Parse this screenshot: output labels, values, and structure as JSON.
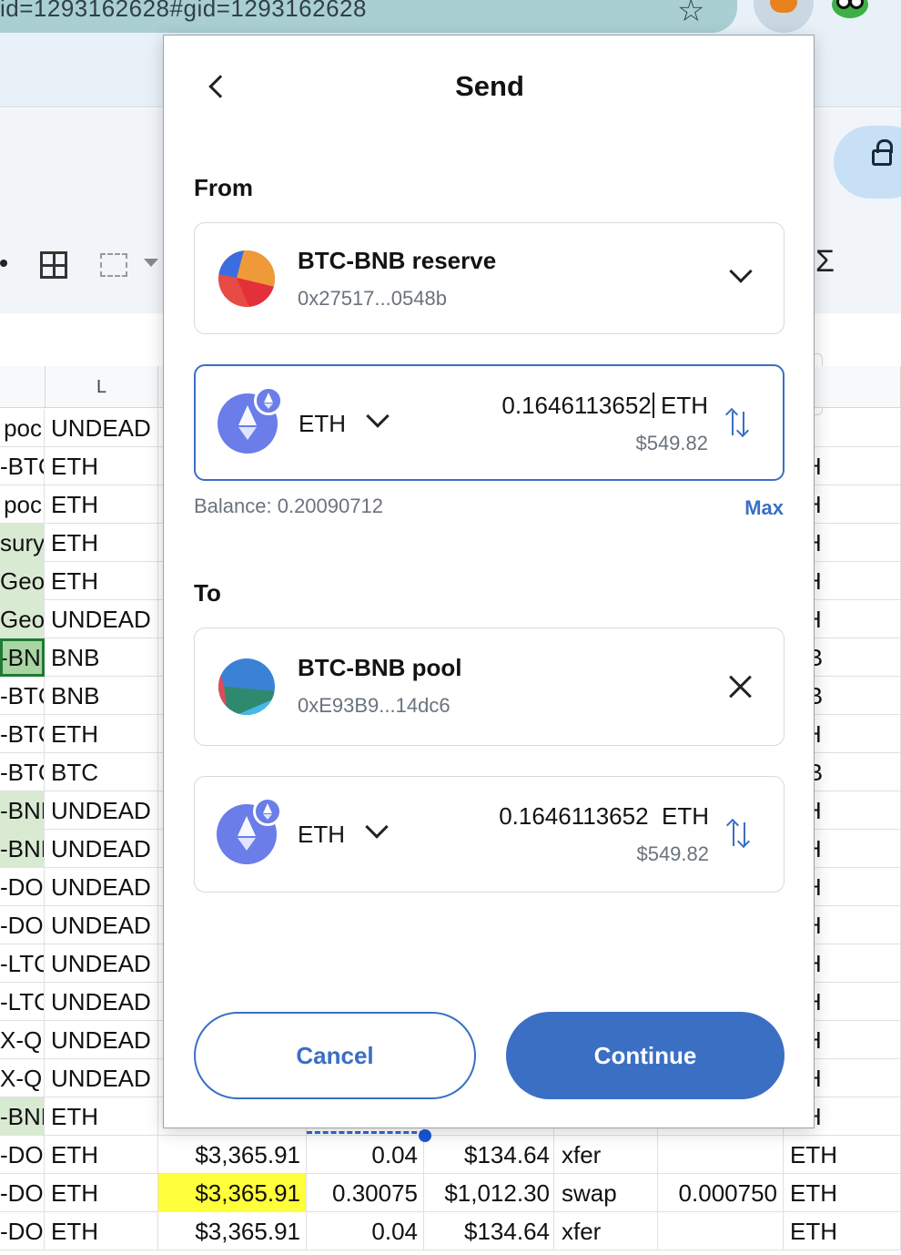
{
  "browser": {
    "url_fragment": "id=1293162628#gid=1293162628"
  },
  "sheet": {
    "col_l_header": "L",
    "rows": [
      {
        "k": " poc",
        "l": "UNDEAD",
        "m": "",
        "n": "",
        "o": "",
        "p": "",
        "q": "",
        "r": ""
      },
      {
        "k": "-BTC",
        "l": "ETH",
        "m": "",
        "n": "",
        "o": "",
        "p": "",
        "q": "",
        "r": "TH"
      },
      {
        "k": " poc",
        "l": "ETH",
        "m": "",
        "n": "",
        "o": "",
        "p": "",
        "q": "",
        "r": "TH"
      },
      {
        "k": "sury",
        "l": "ETH",
        "m": "",
        "n": "",
        "o": "",
        "p": "",
        "q": "",
        "r": "TH"
      },
      {
        "k": "Geo",
        "l": "ETH",
        "m": "",
        "n": "",
        "o": "",
        "p": "",
        "q": "",
        "r": "TH"
      },
      {
        "k": "Geo",
        "l": "UNDEAD",
        "m": "",
        "n": "",
        "o": "",
        "p": "",
        "q": "",
        "r": "TH"
      },
      {
        "k": "-BNE",
        "l": "BNB",
        "m": "",
        "n": "",
        "o": "",
        "p": "",
        "q": "",
        "r": "NB"
      },
      {
        "k": "-BTC",
        "l": "BNB",
        "m": "",
        "n": "",
        "o": "",
        "p": "",
        "q": "",
        "r": "NB"
      },
      {
        "k": "-BTC",
        "l": "ETH",
        "m": "",
        "n": "",
        "o": "",
        "p": "",
        "q": "",
        "r": "TH"
      },
      {
        "k": "-BTC",
        "l": "BTC",
        "m": "",
        "n": "",
        "o": "",
        "p": "",
        "q": "",
        "r": "NB"
      },
      {
        "k": "-BNE",
        "l": "UNDEAD",
        "m": "",
        "n": "",
        "o": "",
        "p": "",
        "q": "",
        "r": "TH"
      },
      {
        "k": "-BNE",
        "l": "UNDEAD",
        "m": "",
        "n": "",
        "o": "",
        "p": "",
        "q": "",
        "r": "TH"
      },
      {
        "k": "-DOC",
        "l": "UNDEAD",
        "m": "",
        "n": "",
        "o": "",
        "p": "",
        "q": "",
        "r": "TH"
      },
      {
        "k": "-DOC",
        "l": "UNDEAD",
        "m": "",
        "n": "",
        "o": "",
        "p": "",
        "q": "",
        "r": "TH"
      },
      {
        "k": "-LTC",
        "l": "UNDEAD",
        "m": "",
        "n": "",
        "o": "",
        "p": "",
        "q": "",
        "r": "TH"
      },
      {
        "k": "-LTC",
        "l": "UNDEAD",
        "m": "",
        "n": "",
        "o": "",
        "p": "",
        "q": "",
        "r": "TH"
      },
      {
        "k": "X-QI",
        "l": "UNDEAD",
        "m": "",
        "n": "",
        "o": "",
        "p": "",
        "q": "",
        "r": "TH"
      },
      {
        "k": "X-QI",
        "l": "UNDEAD",
        "m": "",
        "n": "",
        "o": "",
        "p": "",
        "q": "",
        "r": "TH"
      },
      {
        "k": "-BNE",
        "l": "ETH",
        "m": "",
        "n": "",
        "o": "",
        "p": "",
        "q": "",
        "r": "TH"
      },
      {
        "k": "-DOC",
        "l": "ETH",
        "m": "$3,365.91",
        "n": "0.04",
        "o": "$134.64",
        "p": "xfer",
        "q": "",
        "r": "ETH"
      },
      {
        "k": "-DOC",
        "l": "ETH",
        "m": "$3,365.91",
        "n": "0.30075",
        "o": "$1,012.30",
        "p": "swap",
        "q": "0.000750",
        "r": "ETH"
      },
      {
        "k": "-DOC",
        "l": "ETH",
        "m": "$3,365.91",
        "n": "0.04",
        "o": "$134.64",
        "p": "xfer",
        "q": "",
        "r": "ETH"
      }
    ]
  },
  "send": {
    "title": "Send",
    "from_label": "From",
    "from_account": {
      "name": "BTC-BNB reserve",
      "address": "0x27517...0548b"
    },
    "from_token": {
      "symbol": "ETH",
      "amount": "0.1646113652",
      "unit": "ETH",
      "fiat": "$549.82"
    },
    "balance_text": "Balance: 0.20090712",
    "max_label": "Max",
    "to_label": "To",
    "to_account": {
      "name": "BTC-BNB pool",
      "address": "0xE93B9...14dc6"
    },
    "to_token": {
      "symbol": "ETH",
      "amount": "0.1646113652",
      "unit": "ETH",
      "fiat": "$549.82"
    },
    "cancel_label": "Cancel",
    "continue_label": "Continue"
  },
  "icons": {
    "back": "chevron-left-icon",
    "account_dropdown": "chevron-down-icon",
    "token_dropdown": "chevron-down-icon",
    "swap_currency": "swap-vertical-icon",
    "clear_recipient": "close-icon",
    "eth_token": "ethereum-token-icon",
    "network_badge": "ethereum-network-icon"
  },
  "colors": {
    "accent": "#3a6fc4",
    "muted_text": "#6a737d",
    "eth_purple": "#6a7de8",
    "highlight_yellow": "#ffff3b",
    "cell_green": "#d9ead3"
  }
}
